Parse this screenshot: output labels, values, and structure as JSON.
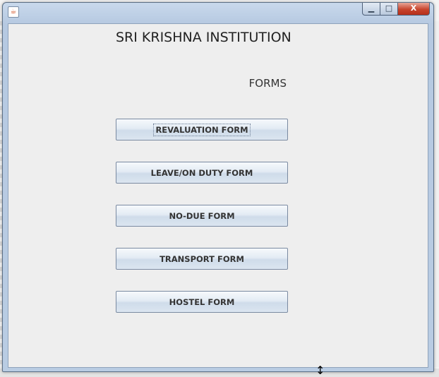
{
  "window": {
    "icon": "java-cup-icon",
    "controls": {
      "minimize": "▁",
      "maximize": "□",
      "close": "X"
    }
  },
  "main": {
    "title": "SRI KRISHNA INSTITUTION",
    "subtitle": "FORMS",
    "buttons": [
      {
        "label": "REVALUATION FORM"
      },
      {
        "label": "LEAVE/ON DUTY FORM"
      },
      {
        "label": "NO-DUE FORM"
      },
      {
        "label": "TRANSPORT FORM"
      },
      {
        "label": "HOSTEL FORM"
      }
    ]
  },
  "cursor": {
    "icon": "resize-vertical-cursor-icon",
    "glyph": "↕"
  }
}
